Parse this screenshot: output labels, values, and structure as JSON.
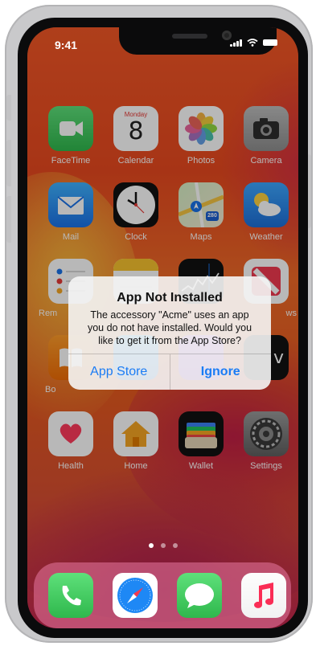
{
  "status_bar": {
    "time": "9:41"
  },
  "apps": [
    {
      "name": "FaceTime"
    },
    {
      "name": "Calendar",
      "weekday": "Monday",
      "day": "8"
    },
    {
      "name": "Photos"
    },
    {
      "name": "Camera"
    },
    {
      "name": "Mail"
    },
    {
      "name": "Clock"
    },
    {
      "name": "Maps",
      "route_shield": "280"
    },
    {
      "name": "Weather"
    },
    {
      "name": "Reminders"
    },
    {
      "name": "Notes"
    },
    {
      "name": "Stocks"
    },
    {
      "name": "News"
    },
    {
      "name": "Books"
    },
    {
      "name": "App Store"
    },
    {
      "name": "Podcasts"
    },
    {
      "name": "TV"
    },
    {
      "name": "Health"
    },
    {
      "name": "Home"
    },
    {
      "name": "Wallet"
    },
    {
      "name": "Settings"
    }
  ],
  "visible_labels": {
    "facetime": "FaceTime",
    "calendar": "Calendar",
    "photos": "Photos",
    "camera": "Camera",
    "mail": "Mail",
    "clock": "Clock",
    "maps": "Maps",
    "weather": "Weather",
    "reminders_partial": "Rem",
    "news_partial": "ws",
    "books_partial": "Bo",
    "health": "Health",
    "home": "Home",
    "wallet": "Wallet",
    "settings": "Settings"
  },
  "page_indicator": {
    "pages": 3,
    "current": 1
  },
  "dock": [
    "Phone",
    "Safari",
    "Messages",
    "Music"
  ],
  "alert": {
    "title": "App Not Installed",
    "message": "The accessory \"Acme\" uses an app you do not have installed. Would you like to get it from the App Store?",
    "actions": {
      "primary": "App Store",
      "secondary": "Ignore"
    }
  },
  "colors": {
    "wallpaper_top": "#f35726",
    "wallpaper_bottom": "#c2264f",
    "alert_button": "#1a7cf5"
  }
}
